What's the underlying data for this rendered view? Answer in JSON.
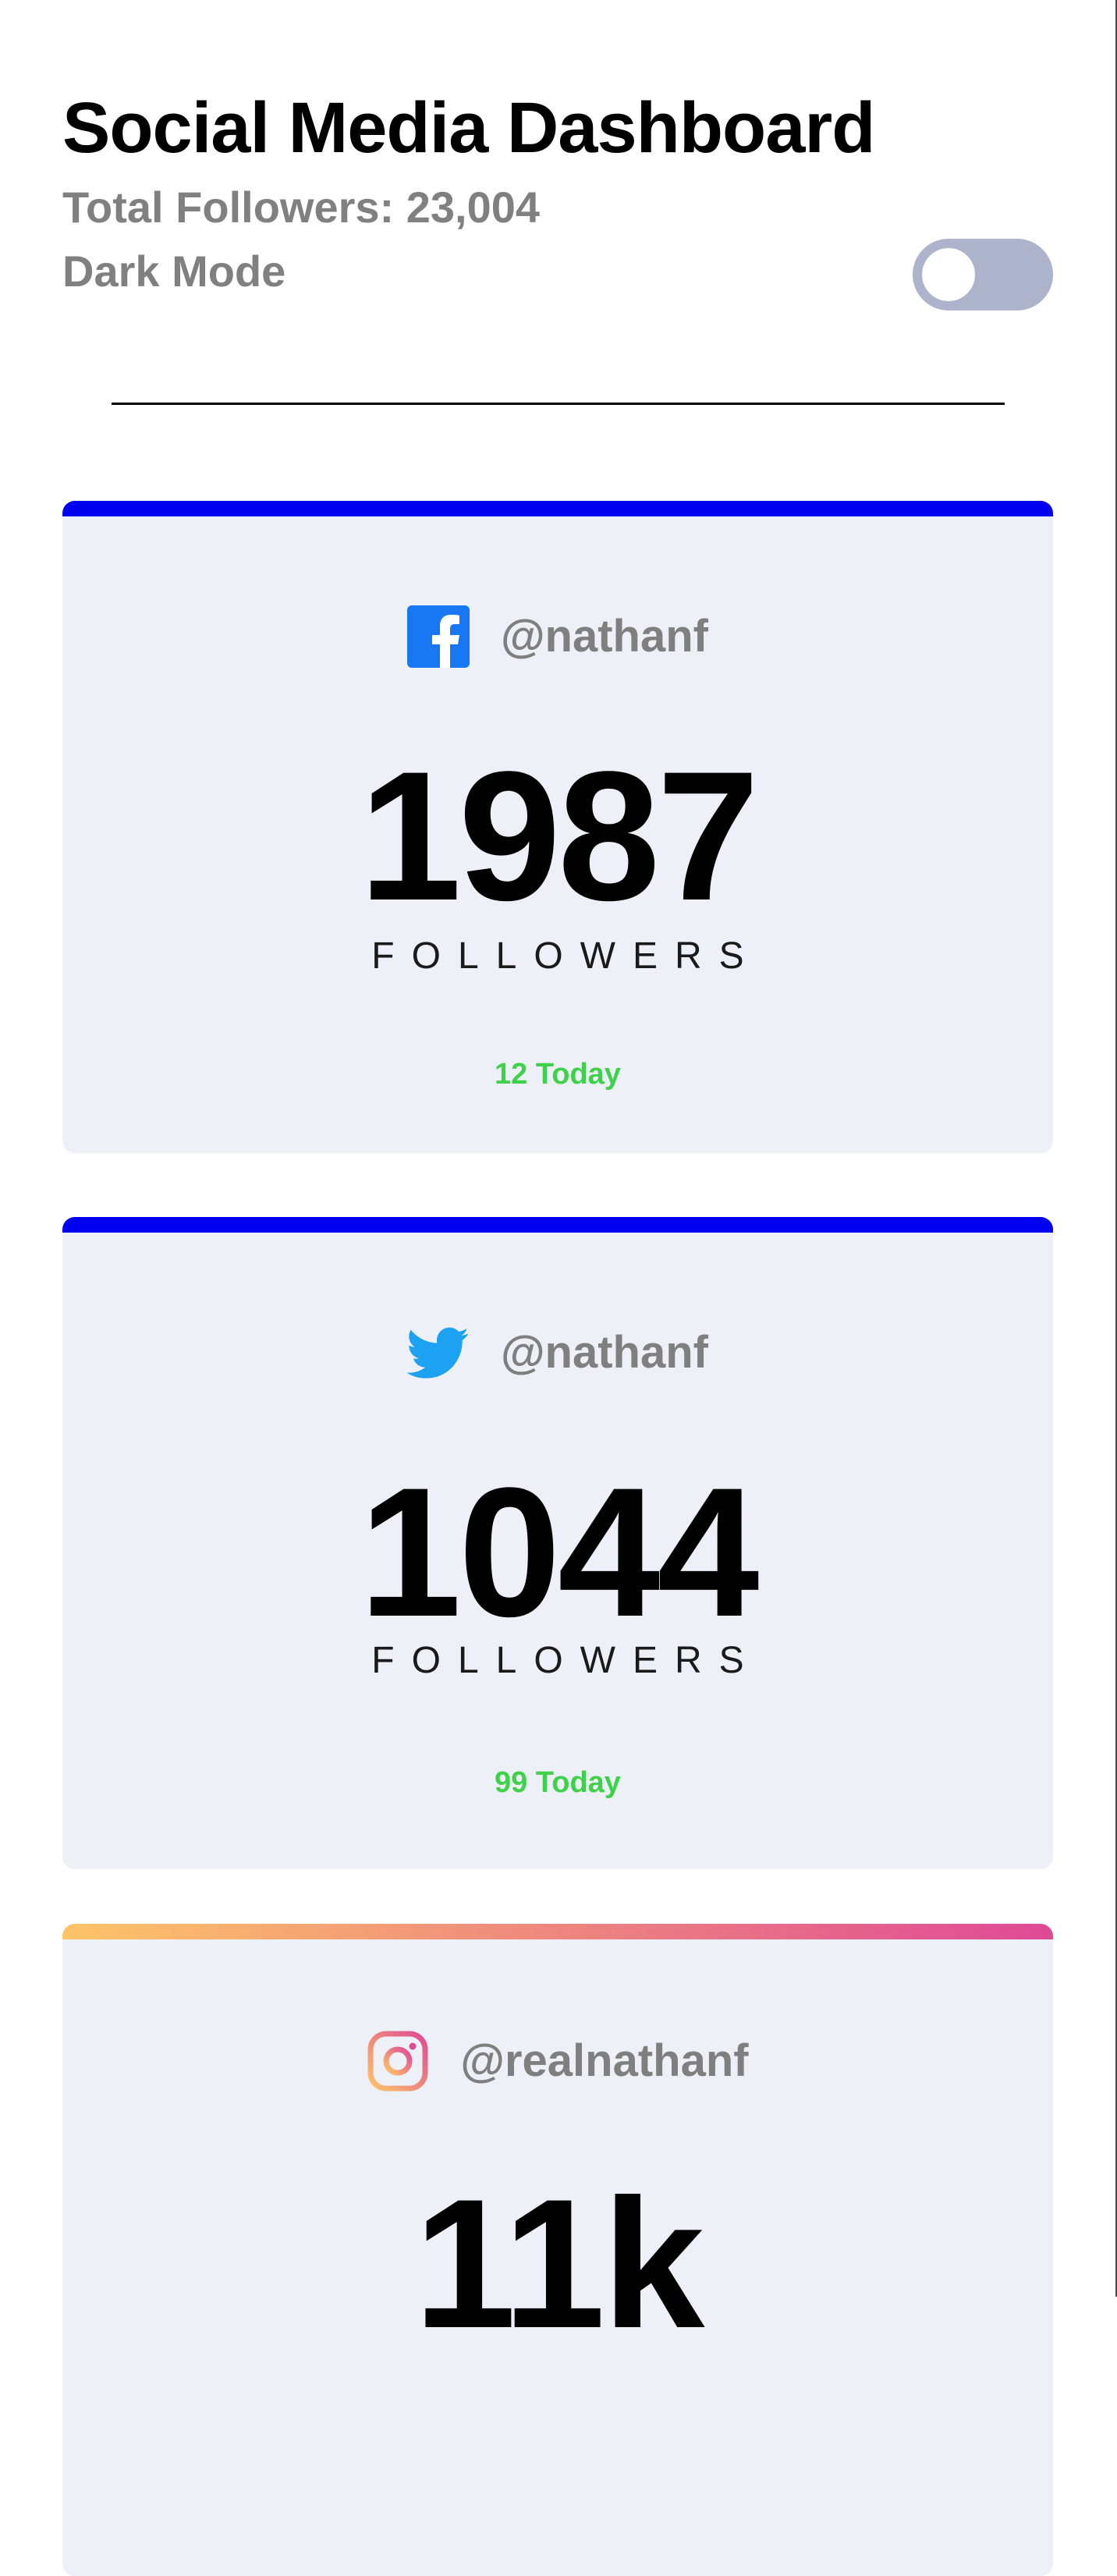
{
  "header": {
    "title": "Social Media Dashboard",
    "total_followers": "Total Followers: 23,004",
    "dark_mode_label": "Dark Mode",
    "dark_mode_on": false
  },
  "cards": [
    {
      "platform_icon": "facebook-icon",
      "accent": "#0000ee",
      "handle": "@nathanf",
      "count": "1987",
      "label": "FOLLOWERS",
      "today": "12 Today"
    },
    {
      "platform_icon": "twitter-icon",
      "accent": "#0000ee",
      "handle": "@nathanf",
      "count": "1044",
      "label": "FOLLOWERS",
      "today": "99 Today"
    },
    {
      "platform_icon": "instagram-icon",
      "accent": "gradient #fdc468 to #df4996",
      "handle": "@realnathanf",
      "count": "11k"
    }
  ],
  "colors": {
    "today_positive": "#3ed24a",
    "card_background": "#eef0f7",
    "toggle_track": "#aeb3cc",
    "facebook": "#1877f2",
    "twitter": "#1da1f2"
  }
}
